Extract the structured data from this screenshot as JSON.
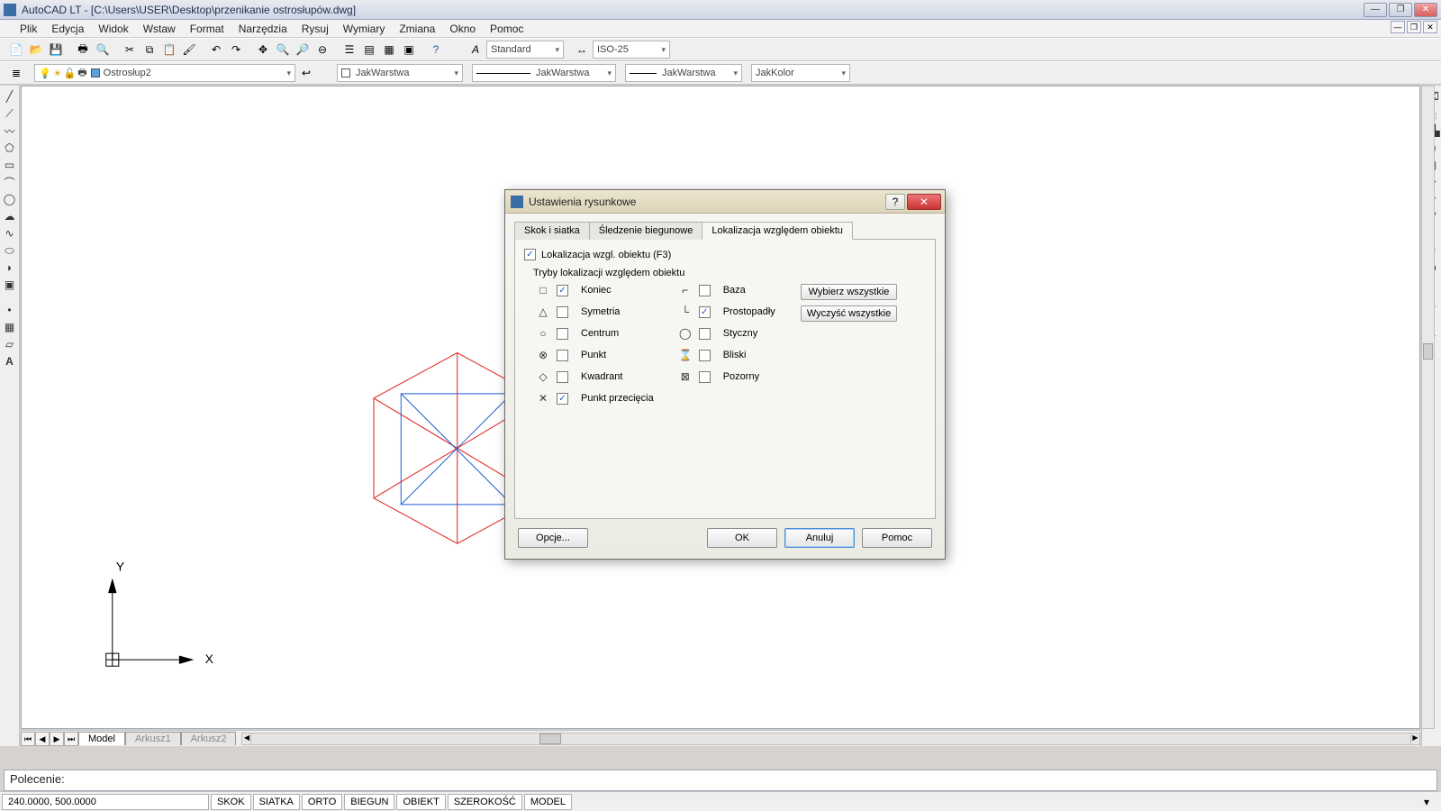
{
  "title": "AutoCAD LT - [C:\\Users\\USER\\Desktop\\przenikanie ostrosłupów.dwg]",
  "menu": [
    "Plik",
    "Edycja",
    "Widok",
    "Wstaw",
    "Format",
    "Narzędzia",
    "Rysuj",
    "Wymiary",
    "Zmiana",
    "Okno",
    "Pomoc"
  ],
  "toolbar1": {
    "text_style": "Standard",
    "dim_style": "ISO-25"
  },
  "toolbar2": {
    "layer": "Ostrosłup2",
    "layer_like": "JakWarstwa",
    "linetype": "JakWarstwa",
    "lineweight": "JakWarstwa",
    "color": "JakKolor"
  },
  "sheets": {
    "active": "Model",
    "others": [
      "Arkusz1",
      "Arkusz2"
    ]
  },
  "command_prompt": "Polecenie:",
  "status": {
    "coords": "240.0000, 500.0000",
    "toggles": [
      "SKOK",
      "SIATKA",
      "ORTO",
      "BIEGUN",
      "OBIEKT",
      "SZEROKOŚĆ",
      "MODEL"
    ]
  },
  "axes": {
    "x": "X",
    "y": "Y"
  },
  "dialog": {
    "title": "Ustawienia rysunkowe",
    "tabs": [
      "Skok i siatka",
      "Śledzenie biegunowe",
      "Lokalizacja względem obiektu"
    ],
    "active_tab": 2,
    "enable_label": "Lokalizacja wzgl. obiektu (F3)",
    "enable_checked": true,
    "group_label": "Tryby lokalizacji względem obiektu",
    "modes_left": [
      {
        "icon": "□",
        "label": "Koniec",
        "checked": true
      },
      {
        "icon": "△",
        "label": "Symetria",
        "checked": false
      },
      {
        "icon": "○",
        "label": "Centrum",
        "checked": false
      },
      {
        "icon": "⊗",
        "label": "Punkt",
        "checked": false
      },
      {
        "icon": "◇",
        "label": "Kwadrant",
        "checked": false
      },
      {
        "icon": "✕",
        "label": "Punkt przecięcia",
        "checked": true
      }
    ],
    "modes_right": [
      {
        "icon": "⌐",
        "label": "Baza",
        "checked": false
      },
      {
        "icon": "└",
        "label": "Prostopadły",
        "checked": true
      },
      {
        "icon": "◯",
        "label": "Styczny",
        "checked": false
      },
      {
        "icon": "⌛",
        "label": "Bliski",
        "checked": false
      },
      {
        "icon": "⊠",
        "label": "Pozorny",
        "checked": false
      }
    ],
    "select_all": "Wybierz wszystkie",
    "clear_all": "Wyczyść wszystkie",
    "options": "Opcje...",
    "ok": "OK",
    "cancel": "Anuluj",
    "help": "Pomoc"
  }
}
